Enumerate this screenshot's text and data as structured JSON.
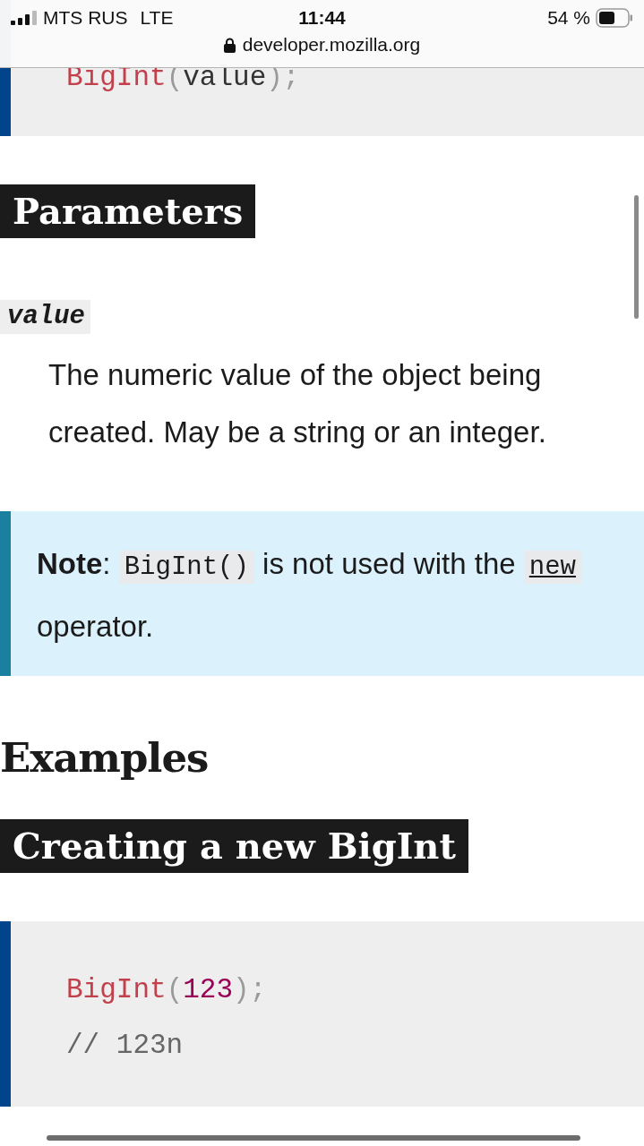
{
  "status_bar": {
    "carrier": "MTS RUS",
    "network": "LTE",
    "time": "11:44",
    "battery": "54 %"
  },
  "address_bar": {
    "url": "developer.mozilla.org"
  },
  "content": [
    {
      "kind": "code",
      "lines": [
        [
          {
            "kind": "function",
            "text": "BigInt"
          },
          {
            "kind": "punctuation",
            "text": "("
          },
          {
            "kind": "plain",
            "text": "value"
          },
          {
            "kind": "punctuation",
            "text": ");"
          }
        ]
      ]
    },
    {
      "kind": "subheading",
      "text": "Parameters"
    },
    {
      "kind": "term",
      "text": "value"
    },
    {
      "kind": "definition",
      "text": "The numeric value of the object being created. May be a string or an integer."
    },
    {
      "kind": "note",
      "parts": [
        {
          "kind": "label",
          "text": "Note"
        },
        {
          "kind": "text",
          "text": ": "
        },
        {
          "kind": "code",
          "text": "BigInt()"
        },
        {
          "kind": "text",
          "text": " is not used with the "
        },
        {
          "kind": "code_link",
          "text": "new"
        },
        {
          "kind": "text",
          "text": " operator."
        }
      ]
    },
    {
      "kind": "heading",
      "text": "Examples"
    },
    {
      "kind": "subheading",
      "text": "Creating a new BigInt"
    },
    {
      "kind": "code",
      "lines": [
        [
          {
            "kind": "function",
            "text": "BigInt"
          },
          {
            "kind": "punctuation",
            "text": "("
          },
          {
            "kind": "number",
            "text": "123"
          },
          {
            "kind": "punctuation",
            "text": ");"
          }
        ],
        [
          {
            "kind": "comment",
            "text": "// 123n"
          }
        ]
      ]
    }
  ]
}
